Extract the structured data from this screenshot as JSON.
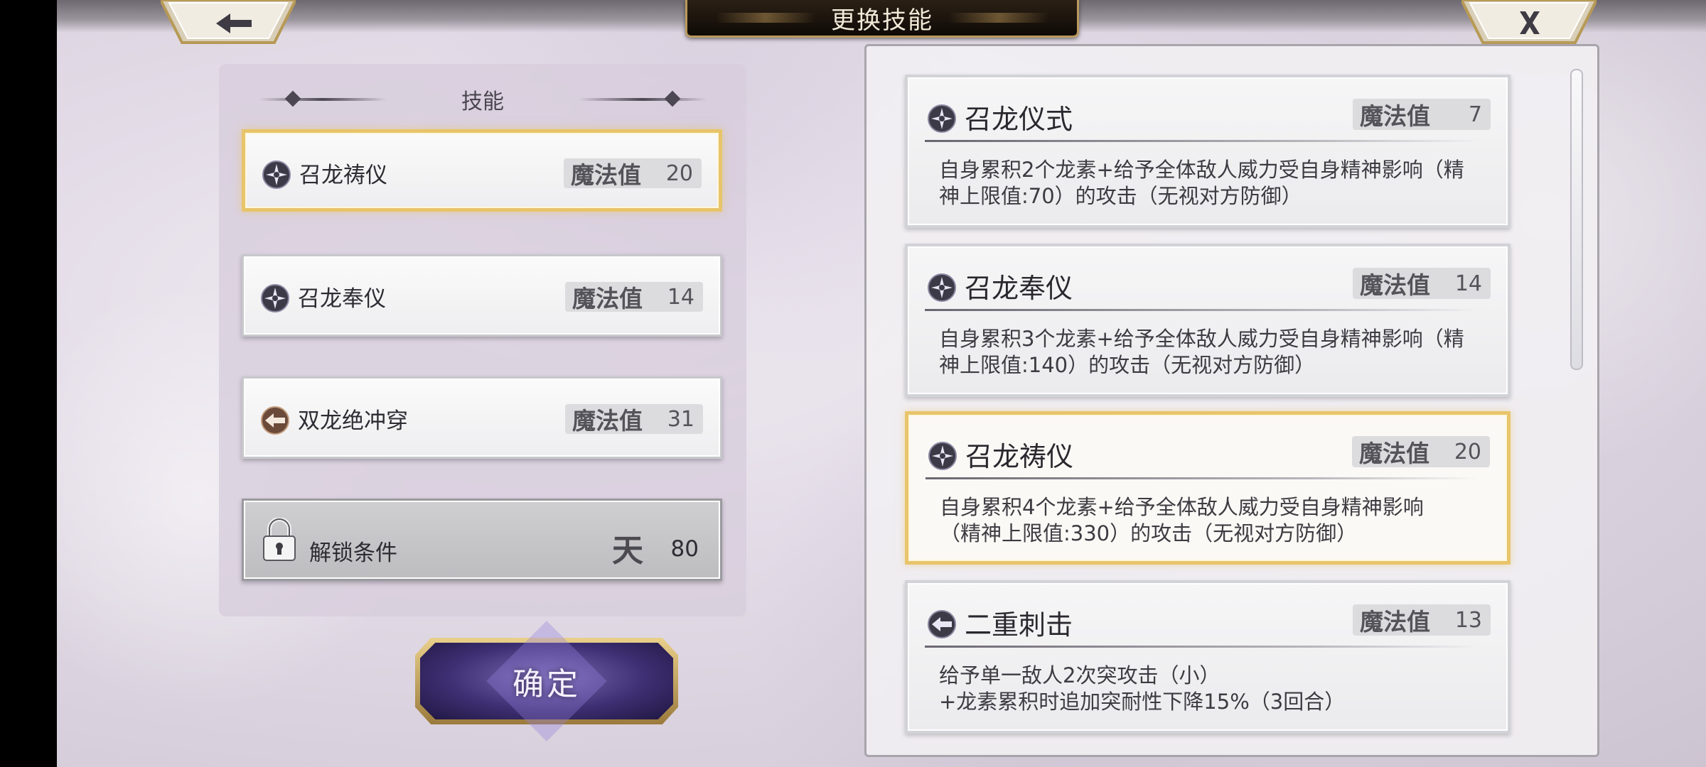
{
  "header": {
    "title": "更换技能"
  },
  "left_panel": {
    "title": "技能",
    "slots": [
      {
        "name": "召龙祷仪",
        "mp_label": "魔法值",
        "mp": "20",
        "icon": "star-rune-icon",
        "selected": true
      },
      {
        "name": "召龙奉仪",
        "mp_label": "魔法值",
        "mp": "14",
        "icon": "star-rune-icon",
        "selected": false
      },
      {
        "name": "双龙绝冲穿",
        "mp_label": "魔法值",
        "mp": "31",
        "icon": "pierce-arrow-icon",
        "selected": false
      }
    ],
    "locked_slot": {
      "label": "解锁条件",
      "glyph": "天",
      "value": "80"
    },
    "confirm_label": "确定"
  },
  "skill_list": [
    {
      "name": "召龙仪式",
      "mp_label": "魔法值",
      "mp": "7",
      "desc": "自身累积2个龙素+给予全体敌人威力受自身精神影响（精神上限值:70）的攻击（无视对方防御）",
      "icon": "star-rune-icon",
      "selected": false
    },
    {
      "name": "召龙奉仪",
      "mp_label": "魔法值",
      "mp": "14",
      "desc": "自身累积3个龙素+给予全体敌人威力受自身精神影响（精神上限值:140）的攻击（无视对方防御）",
      "icon": "star-rune-icon",
      "selected": false
    },
    {
      "name": "召龙祷仪",
      "mp_label": "魔法值",
      "mp": "20",
      "desc": "自身累积4个龙素+给予全体敌人威力受自身精神影响（精神上限值:330）的攻击（无视对方防御）",
      "icon": "star-rune-icon",
      "selected": true
    },
    {
      "name": "二重刺击",
      "mp_label": "魔法值",
      "mp": "13",
      "desc_lines": [
        "给予单一敌人2次突攻击（小）",
        "+龙素累积时追加突耐性下降15%（3回合）"
      ],
      "icon": "pierce-arrow-icon",
      "selected": false
    }
  ],
  "colors": {
    "selected_border": "#e8c46b",
    "confirm_bg": "#3e2f73"
  }
}
